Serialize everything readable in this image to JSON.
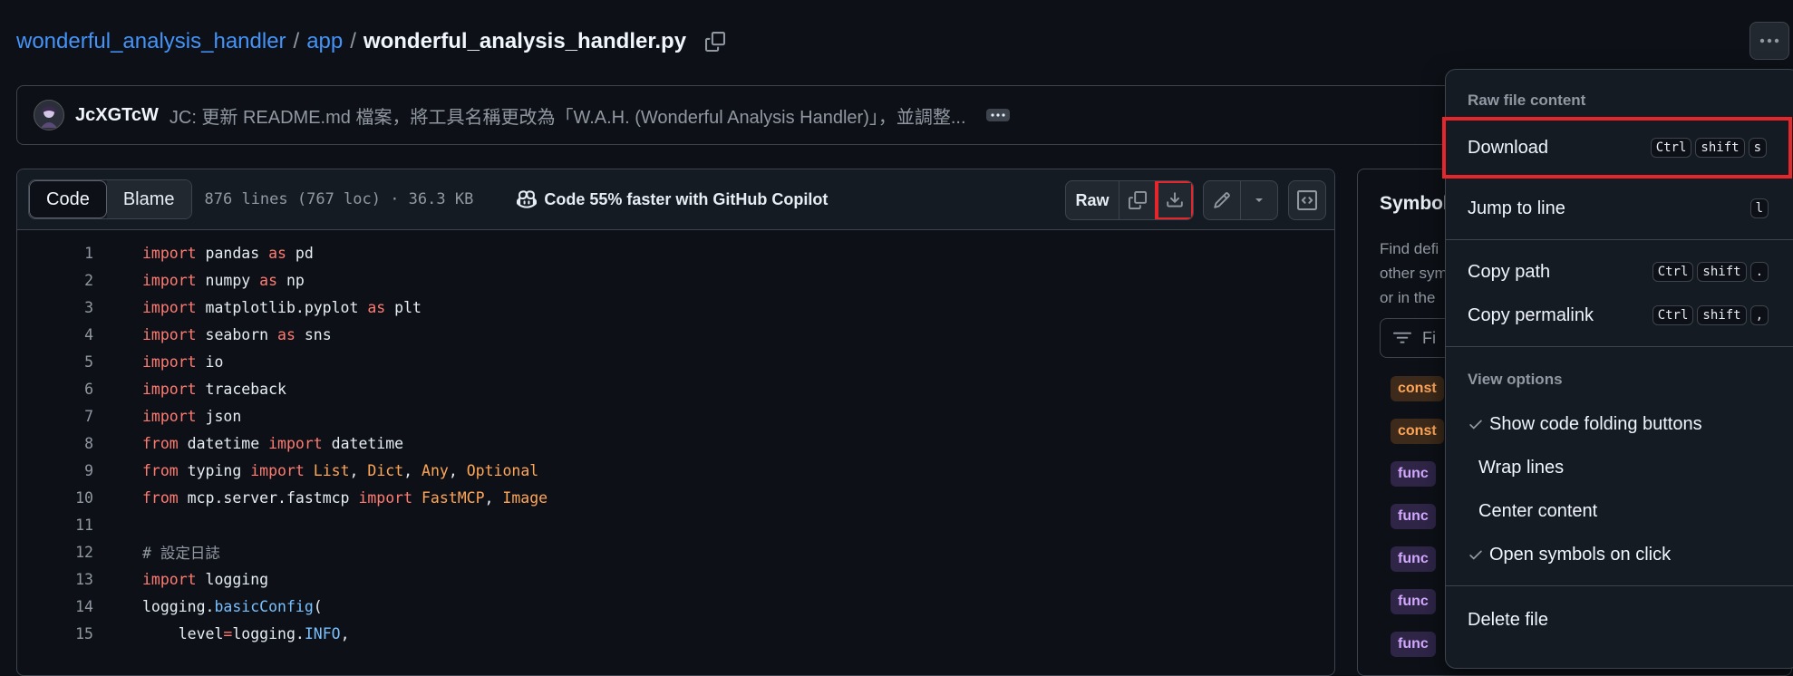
{
  "breadcrumb": {
    "repo": "wonderful_analysis_handler",
    "sep1": "/",
    "folder": "app",
    "sep2": "/",
    "file": "wonderful_analysis_handler.py"
  },
  "commit": {
    "author": "JcXGTcW",
    "message": "JC: 更新 README.md 檔案，將工具名稱更改為「W.A.H. (Wonderful Analysis Handler)」，並調整..."
  },
  "toolbar": {
    "code_tab": "Code",
    "blame_tab": "Blame",
    "file_meta": "876 lines (767 loc) · 36.3 KB",
    "copilot": "Code 55% faster with GitHub Copilot",
    "raw": "Raw"
  },
  "code_lines": [
    {
      "n": "1"
    },
    {
      "n": "2"
    },
    {
      "n": "3"
    },
    {
      "n": "4"
    },
    {
      "n": "5"
    },
    {
      "n": "6"
    },
    {
      "n": "7"
    },
    {
      "n": "8"
    },
    {
      "n": "9"
    },
    {
      "n": "10"
    },
    {
      "n": "11"
    },
    {
      "n": "12"
    },
    {
      "n": "13"
    },
    {
      "n": "14"
    },
    {
      "n": "15"
    }
  ],
  "code": {
    "l1": [
      "import",
      " pandas ",
      "as",
      " pd"
    ],
    "l2": [
      "import",
      " numpy ",
      "as",
      " np"
    ],
    "l3": [
      "import",
      " matplotlib.pyplot ",
      "as",
      " plt"
    ],
    "l4": [
      "import",
      " seaborn ",
      "as",
      " sns"
    ],
    "l5": [
      "import",
      " io"
    ],
    "l6": [
      "import",
      " traceback"
    ],
    "l7": [
      "import",
      " json"
    ],
    "l8": [
      "from",
      " datetime ",
      "import",
      " datetime"
    ],
    "l9": [
      "from",
      " typing ",
      "import",
      " ",
      "List",
      ", ",
      "Dict",
      ", ",
      "Any",
      ", ",
      "Optional"
    ],
    "l10": [
      "from",
      " mcp.server.fastmcp ",
      "import",
      " ",
      "FastMCP",
      ", ",
      "Image"
    ],
    "l12": "# 設定日誌",
    "l13": [
      "import",
      " logging"
    ],
    "l14": [
      "logging.",
      "basicConfig",
      "("
    ],
    "l15": [
      "    level",
      "=",
      "logging.",
      "INFO",
      ","
    ]
  },
  "symbols": {
    "title": "Symbol",
    "desc": "Find defi\nother sym\nor in the",
    "filter_placeholder": "Fi",
    "badges": [
      "const",
      "const",
      "func",
      "func",
      "func",
      "func",
      "func"
    ]
  },
  "menu": {
    "group1_title": "Raw file content",
    "download": "Download",
    "download_keys": [
      "Ctrl",
      "shift",
      "s"
    ],
    "jump": "Jump to line",
    "jump_keys": [
      "l"
    ],
    "copy_path": "Copy path",
    "copy_path_keys": [
      "Ctrl",
      "shift",
      "."
    ],
    "copy_permalink": "Copy permalink",
    "copy_permalink_keys": [
      "Ctrl",
      "shift",
      ","
    ],
    "group2_title": "View options",
    "show_folding": "Show code folding buttons",
    "wrap_lines": "Wrap lines",
    "center_content": "Center content",
    "open_symbols": "Open symbols on click",
    "delete_file": "Delete file"
  },
  "colors": {
    "highlight": "#e5262b",
    "link": "#4493f8",
    "keyword": "#ff7b72",
    "type": "#ffa657",
    "function": "#79c0ff"
  }
}
